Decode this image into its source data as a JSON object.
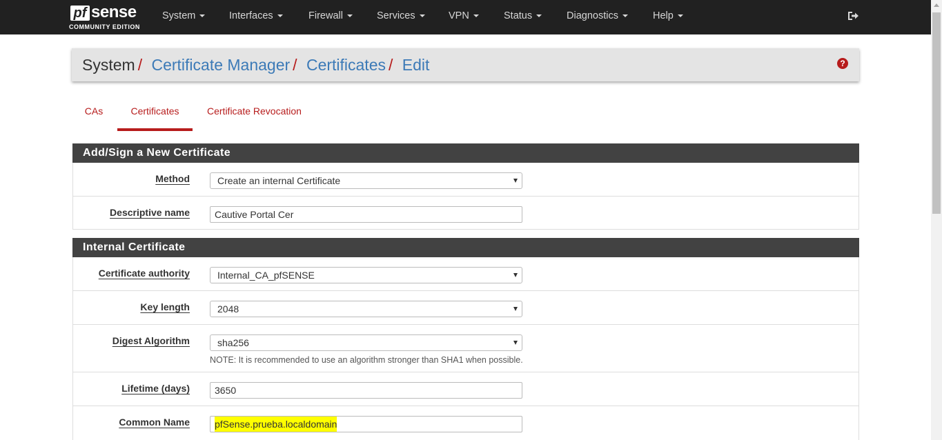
{
  "brand": {
    "name_pf": "pf",
    "name_sense": "sense",
    "edition": "COMMUNITY EDITION"
  },
  "nav": [
    {
      "label": "System"
    },
    {
      "label": "Interfaces"
    },
    {
      "label": "Firewall"
    },
    {
      "label": "Services"
    },
    {
      "label": "VPN"
    },
    {
      "label": "Status"
    },
    {
      "label": "Diagnostics"
    },
    {
      "label": "Help"
    }
  ],
  "breadcrumb": {
    "first": "System",
    "sep": "/",
    "links": [
      "Certificate Manager",
      "Certificates",
      "Edit"
    ]
  },
  "help_icon_glyph": "?",
  "tabs": [
    {
      "label": "CAs",
      "active": false
    },
    {
      "label": "Certificates",
      "active": true
    },
    {
      "label": "Certificate Revocation",
      "active": false
    }
  ],
  "panels": {
    "new_cert": {
      "title": "Add/Sign a New Certificate",
      "method": {
        "label": "Method",
        "value": "Create an internal Certificate"
      },
      "descr": {
        "label": "Descriptive name",
        "value": "Cautive Portal Cer"
      }
    },
    "internal": {
      "title": "Internal Certificate",
      "ca": {
        "label": "Certificate authority",
        "value": "Internal_CA_pfSENSE"
      },
      "keylen": {
        "label": "Key length",
        "value": "2048"
      },
      "digest": {
        "label": "Digest Algorithm",
        "value": "sha256",
        "note": "NOTE: It is recommended to use an algorithm stronger than SHA1 when possible."
      },
      "lifetime": {
        "label": "Lifetime (days)",
        "value": "3650"
      },
      "cn": {
        "label": "Common Name",
        "value": "pfSense.prueba.localdomain"
      }
    }
  },
  "colors": {
    "accent": "#b71c1c",
    "link": "#3c7ab7",
    "navbar": "#212121",
    "panel_head": "#424242",
    "highlight": "#ffff00"
  }
}
